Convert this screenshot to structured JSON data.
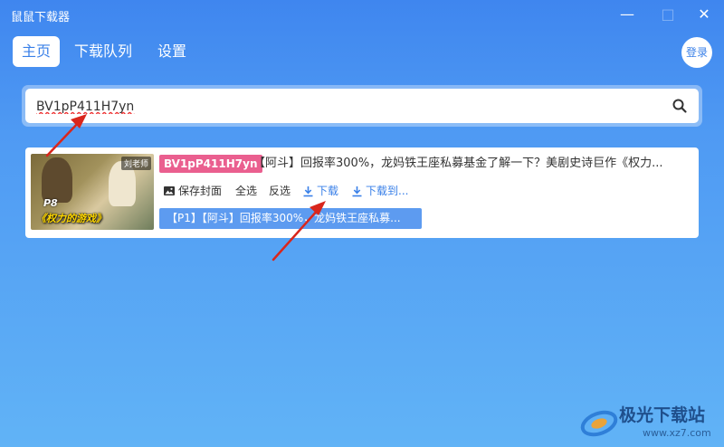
{
  "window": {
    "title": "鼠鼠下载器",
    "minimize_glyph": "—",
    "maximize_glyph": "□",
    "close_glyph": "✕"
  },
  "nav": {
    "tabs": [
      {
        "label": "主页",
        "active": true
      },
      {
        "label": "下载队列",
        "active": false
      },
      {
        "label": "设置",
        "active": false
      }
    ]
  },
  "login_label": "登录",
  "search": {
    "value": "BV1pP411H7yn",
    "icon": "search-icon"
  },
  "result": {
    "thumbnail": {
      "episode": "P8",
      "subtitle": "《权力的游戏》",
      "badge": "刘老师"
    },
    "bv_id": "BV1pP411H7yn",
    "title": "【阿斗】回报率300%，龙妈铁王座私募基金了解一下？美剧史诗巨作《权力...",
    "actions": {
      "save_cover": "保存封面",
      "select_all": "全选",
      "invert": "反选",
      "download": "下载",
      "download_to": "下载到..."
    },
    "part_label": "【P1】【阿斗】回报率300%，龙妈铁王座私募..."
  },
  "watermark": {
    "name": "极光下载站",
    "url": "www.xz7.com"
  },
  "colors": {
    "accent": "#3a80e8",
    "bv_badge": "#ea5f8f",
    "part_button": "#5d9bf0",
    "annotation_arrow": "#d9261c"
  }
}
